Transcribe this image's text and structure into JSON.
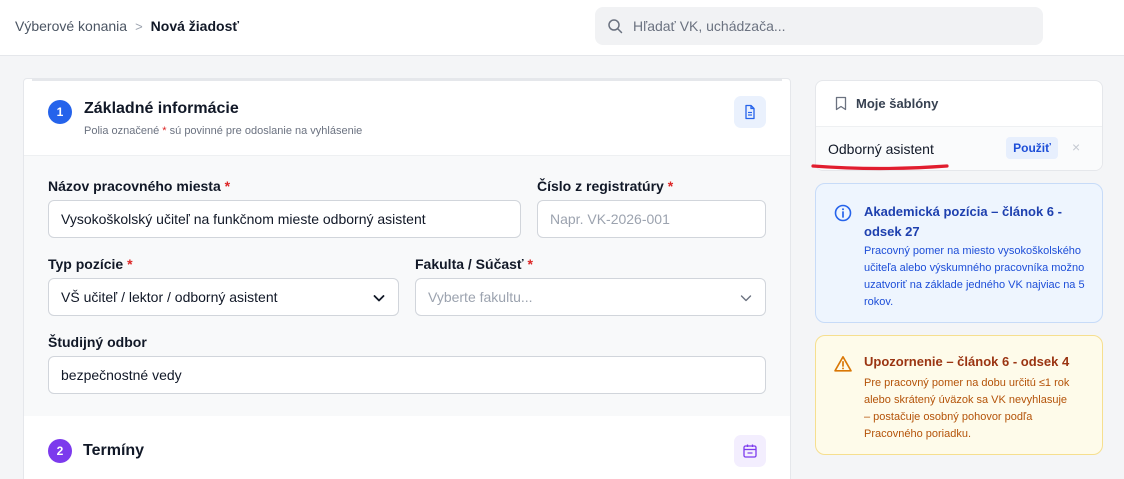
{
  "breadcrumb": {
    "parent": "Výberové konania",
    "separator": ">",
    "current": "Nová žiadosť"
  },
  "search": {
    "placeholder": "Hľadať VK, uchádzača..."
  },
  "section1": {
    "number": "1",
    "title": "Základné informácie",
    "subtitle_prefix": "Polia označené",
    "subtitle_star": "*",
    "subtitle_suffix": "sú povinné pre odoslanie na vyhlásenie"
  },
  "fields": {
    "position_name": {
      "label": "Názov pracovného miesta",
      "required": "*",
      "value": "Vysokoškolský učiteľ na funkčnom mieste odborný asistent"
    },
    "registry_number": {
      "label": "Číslo z registratúry",
      "required": "*",
      "placeholder": "Napr. VK-2026-001"
    },
    "position_type": {
      "label": "Typ pozície",
      "required": "*",
      "value": "VŠ učiteľ / lektor / odborný asistent"
    },
    "faculty": {
      "label": "Fakulta / Súčasť",
      "required": "*",
      "placeholder": "Vyberte fakultu..."
    },
    "study_field": {
      "label": "Študijný odbor",
      "value": "bezpečnostné vedy"
    }
  },
  "section2": {
    "number": "2",
    "title": "Termíny"
  },
  "templates": {
    "title": "Moje šablóny",
    "items": [
      {
        "name": "Odborný asistent",
        "use_label": "Použiť",
        "remove": "×"
      }
    ]
  },
  "info_box": {
    "title": "Akademická pozícia – článok 6 - odsek 27",
    "body": "Pracovný pomer na miesto vysokoškolského učiteľa alebo výskumného pracovníka možno uzatvoriť na základe jedného VK najviac na 5 rokov."
  },
  "warning_box": {
    "title": "Upozornenie – článok 6 - odsek 4",
    "body": "Pre pracovný pomer na dobu určitú ≤1 rok alebo skrátený úväzok sa VK nevyhlasuje – postačuje osobný pohovor podľa Pracovného poriadku."
  },
  "colors": {
    "primary": "#2563eb",
    "step2": "#7c3aed",
    "required": "#dc2626",
    "annotation": "#e11d2e"
  }
}
